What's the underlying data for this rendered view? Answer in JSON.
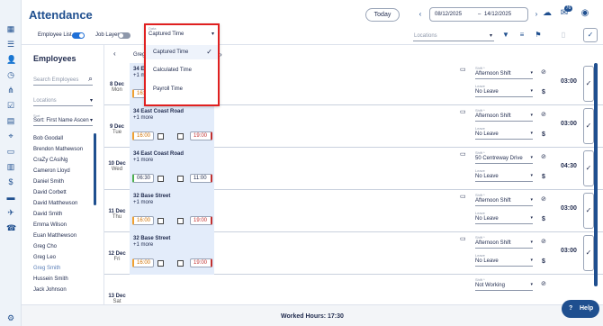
{
  "page": {
    "title": "Attendance"
  },
  "header": {
    "today_label": "Today",
    "date_from": "08/12/2025",
    "date_separator": "–",
    "date_to": "14/12/2025",
    "notification_count": "76"
  },
  "toolbar": {
    "employee_list_label": "Employee List",
    "job_layers_label": "Job Layers",
    "time_type_caption": "Data",
    "time_type_value": "Captured Time",
    "locations_placeholder": "Locations"
  },
  "time_dropdown": {
    "options": [
      "Captured Time",
      "Calculated Time",
      "Payroll Time"
    ]
  },
  "sidebar": {
    "title": "Employees",
    "search_placeholder": "Search Employees",
    "locations_placeholder": "Locations",
    "sort_caption": "Sort",
    "sort_value": "Sort: First Name Ascen",
    "employees": [
      "Bob Goodall",
      "Brendon Mathewson",
      "CraZy CAsiNg",
      "Cameron Lloyd",
      "Daniel Smith",
      "David Corbett",
      "David Matthewson",
      "David Smith",
      "Emma Wilson",
      "Euan Matthewson",
      "Greg Cho",
      "Greg Leo",
      "Greg Smith",
      "Hussein Smith",
      "Jack Johnson"
    ]
  },
  "grid": {
    "header_name": "Greg",
    "rows": [
      {
        "date": "8 Dec",
        "dow": "Mon",
        "location": "34 East",
        "more": "+1 more",
        "start": "16:00",
        "end": "19:00",
        "shift": "Afternoon Shift",
        "leave": "No Leave",
        "hours": "03:00"
      },
      {
        "date": "9 Dec",
        "dow": "Tue",
        "location": "34 East Coast Road",
        "more": "+1 more",
        "start": "16:00",
        "end": "19:00",
        "shift": "Afternoon Shift",
        "leave": "No Leave",
        "hours": "03:00"
      },
      {
        "date": "10 Dec",
        "dow": "Wed",
        "location": "34 East Coast Road",
        "more": "+1 more",
        "start": "06:30",
        "end": "11:00",
        "shift": "50 Centreway Drive",
        "leave": "No Leave",
        "hours": "04:30"
      },
      {
        "date": "11 Dec",
        "dow": "Thu",
        "location": "32 Base Street",
        "more": "+1 more",
        "start": "16:00",
        "end": "19:00",
        "shift": "Afternoon Shift",
        "leave": "No Leave",
        "hours": "03:00"
      },
      {
        "date": "12 Dec",
        "dow": "Fri",
        "location": "32 Base Street",
        "more": "+1 more",
        "start": "16:00",
        "end": "19:00",
        "shift": "Afternoon Shift",
        "leave": "No Leave",
        "hours": "03:00"
      },
      {
        "date": "13 Dec",
        "dow": "Sat",
        "location": "",
        "more": "",
        "start": "",
        "end": "",
        "shift": "Not Working",
        "leave": "",
        "hours": ""
      }
    ],
    "shift_caption": "Shift *",
    "leave_caption": "Leave"
  },
  "footer": {
    "worked_hours": "Worked Hours: 17:30",
    "help_label": "Help"
  },
  "colors": {
    "brand": "#1f4f8f",
    "highlight": "#e02020"
  }
}
